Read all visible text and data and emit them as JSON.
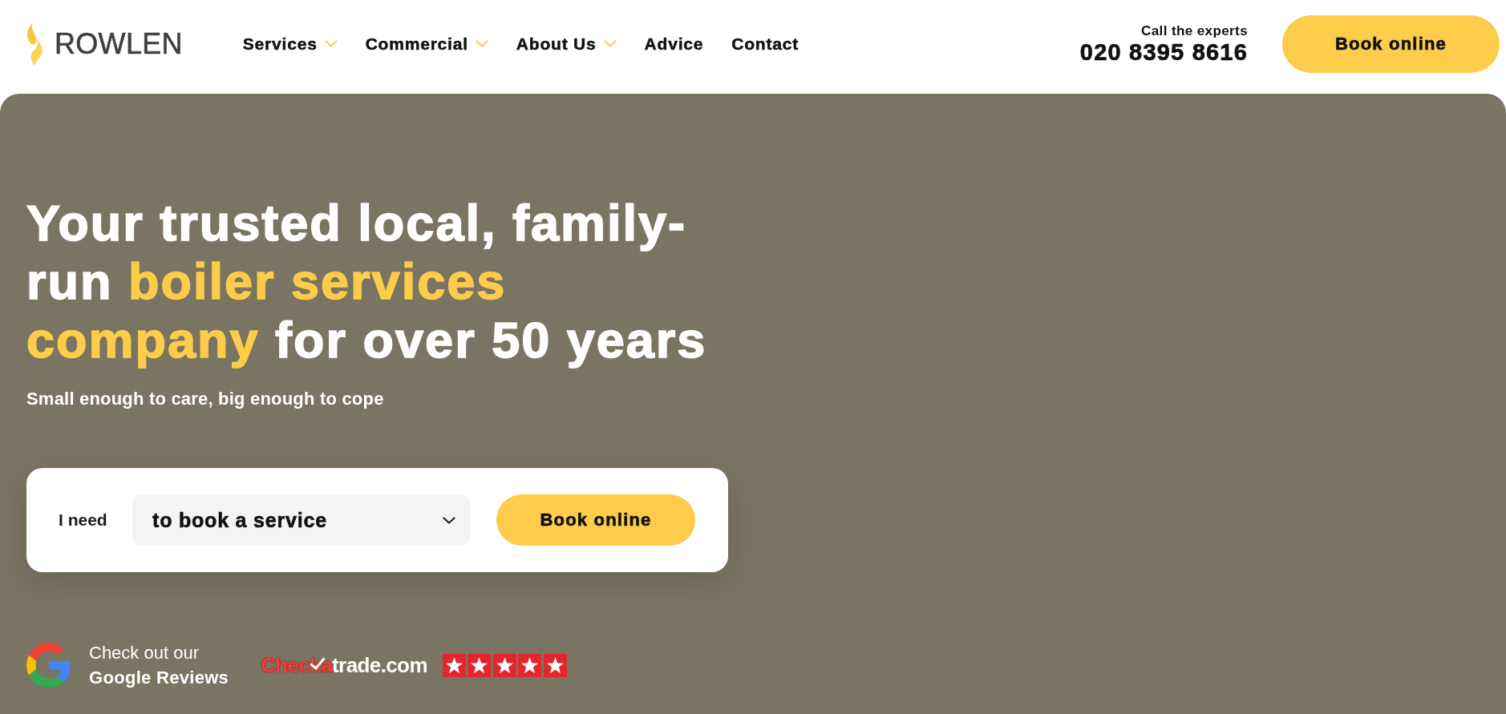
{
  "header": {
    "logo": {
      "wordmark": "ROWLEN"
    },
    "nav": [
      {
        "label": "Services",
        "has_dropdown": true
      },
      {
        "label": "Commercial",
        "has_dropdown": true
      },
      {
        "label": "About Us",
        "has_dropdown": true
      },
      {
        "label": "Advice",
        "has_dropdown": false
      },
      {
        "label": "Contact",
        "has_dropdown": false
      }
    ],
    "call": {
      "caption": "Call the experts",
      "phone": "020 8395 8616"
    },
    "cta": "Book online"
  },
  "hero": {
    "headline": {
      "lines": [
        [
          {
            "text": "Your trusted local, family-",
            "highlight": false
          }
        ],
        [
          {
            "text": "run ",
            "highlight": false
          },
          {
            "text": "boiler services",
            "highlight": true
          }
        ],
        [
          {
            "text": "company",
            "highlight": true
          },
          {
            "text": " for over 50 years",
            "highlight": false
          }
        ]
      ]
    },
    "subtitle": "Small enough to care, big enough to cope",
    "booking": {
      "label": "I need",
      "select": {
        "value": "to book a service"
      },
      "button": "Book online"
    }
  },
  "reviews": {
    "google": {
      "line_1": "Check out our",
      "line_2": "Google Reviews"
    },
    "checkatrade": {
      "lead": "Checka",
      "rest": "trade.com",
      "stars": 5
    }
  }
}
